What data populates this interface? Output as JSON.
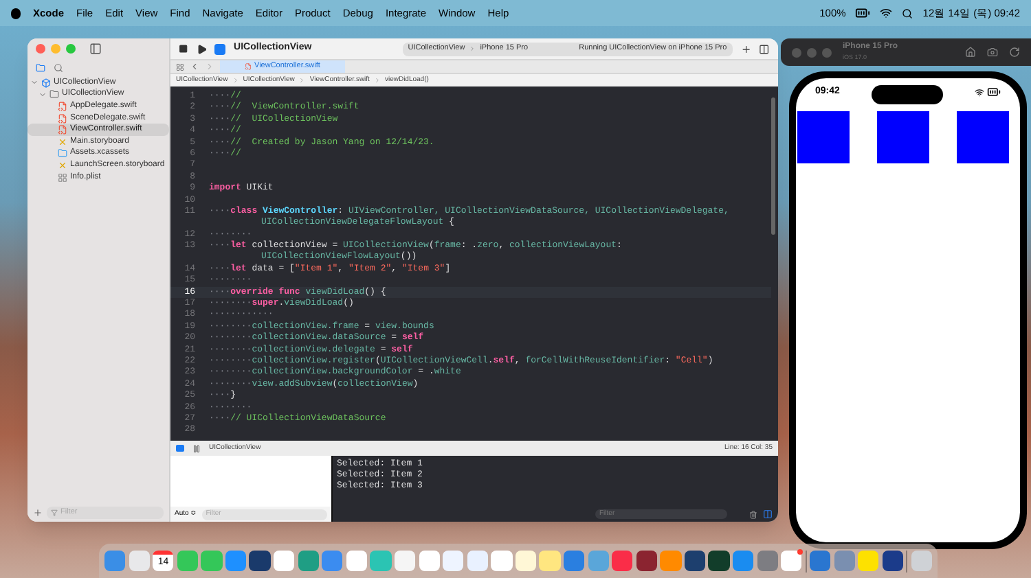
{
  "menu_bar": {
    "items": [
      "Xcode",
      "File",
      "Edit",
      "View",
      "Find",
      "Navigate",
      "Editor",
      "Product",
      "Debug",
      "Integrate",
      "Window",
      "Help"
    ],
    "battery": "100%",
    "clock": "12월 14일 (목) 09:42"
  },
  "xcode": {
    "toolbar": {
      "project": "UICollectionView",
      "scheme": "UICollectionView",
      "device": "iPhone 15 Pro",
      "status": "Running UICollectionView on iPhone 15 Pro"
    },
    "tabs": [
      {
        "label": "ViewController.swift",
        "selected": true
      }
    ],
    "breadcrumb": [
      "UICollectionView",
      "UICollectionView",
      "ViewController.swift",
      "viewDidLoad()"
    ],
    "navigator": {
      "tree": [
        {
          "label": "UICollectionView",
          "kind": "project",
          "expanded": true,
          "selected": false,
          "children": [
            {
              "label": "UICollectionView",
              "kind": "folder",
              "expanded": true,
              "selected": false,
              "children": [
                {
                  "label": "AppDelegate.swift",
                  "kind": "swift",
                  "selected": false
                },
                {
                  "label": "SceneDelegate.swift",
                  "kind": "swift",
                  "selected": false
                },
                {
                  "label": "ViewController.swift",
                  "kind": "swift",
                  "selected": true
                },
                {
                  "label": "Main.storyboard",
                  "kind": "storyboard",
                  "selected": false
                },
                {
                  "label": "Assets.xcassets",
                  "kind": "assets",
                  "selected": false
                },
                {
                  "label": "LaunchScreen.storyboard",
                  "kind": "storyboard",
                  "selected": false
                },
                {
                  "label": "Info.plist",
                  "kind": "plist",
                  "selected": false
                }
              ]
            }
          ]
        }
      ],
      "filter_placeholder": "Filter"
    },
    "editor": {
      "lines": [
        {
          "number": "1",
          "selected": false,
          "tokens": [
            {
              "kind": "space",
              "text": "····"
            },
            {
              "kind": "comment",
              "text": "//"
            }
          ]
        },
        {
          "number": "2",
          "selected": false,
          "tokens": [
            {
              "kind": "space",
              "text": "····"
            },
            {
              "kind": "comment",
              "text": "//  ViewController.swift"
            }
          ]
        },
        {
          "number": "3",
          "selected": false,
          "tokens": [
            {
              "kind": "space",
              "text": "····"
            },
            {
              "kind": "comment",
              "text": "//  UICollectionView"
            }
          ]
        },
        {
          "number": "4",
          "selected": false,
          "tokens": [
            {
              "kind": "space",
              "text": "····"
            },
            {
              "kind": "comment",
              "text": "//"
            }
          ]
        },
        {
          "number": "5",
          "selected": false,
          "tokens": [
            {
              "kind": "space",
              "text": "····"
            },
            {
              "kind": "comment",
              "text": "//  Created by Jason Yang on 12/14/23."
            }
          ]
        },
        {
          "number": "6",
          "selected": false,
          "tokens": [
            {
              "kind": "space",
              "text": "····"
            },
            {
              "kind": "comment",
              "text": "//"
            }
          ]
        },
        {
          "number": "7",
          "selected": false
        },
        {
          "number": "8",
          "selected": false
        },
        {
          "number": "9",
          "selected": false,
          "tokens": [
            {
              "kind": "keyword",
              "text": "import"
            },
            {
              "kind": "plain",
              "text": " UIKit"
            }
          ]
        },
        {
          "number": "10",
          "selected": false
        },
        {
          "number": "11",
          "selected": false,
          "tokens": [
            {
              "kind": "space",
              "text": "····"
            },
            {
              "kind": "keyword",
              "text": "class "
            },
            {
              "kind": "decl",
              "text": "ViewController"
            },
            {
              "kind": "plain",
              "text": ": "
            },
            {
              "kind": "type",
              "text": "UIViewController, UICollectionViewDataSource, UICollectionViewDelegate,"
            }
          ],
          "wrap": [
            {
              "kind": "type",
              "text": "UICollectionViewDelegateFlowLayout"
            },
            {
              "kind": "plain",
              "text": " {"
            }
          ]
        },
        {
          "number": "12",
          "selected": false,
          "tokens": [
            {
              "kind": "space",
              "text": "········"
            }
          ]
        },
        {
          "number": "13",
          "selected": false,
          "tokens": [
            {
              "kind": "space",
              "text": "····"
            },
            {
              "kind": "keyword",
              "text": "let"
            },
            {
              "kind": "plain",
              "text": " collectionView = "
            },
            {
              "kind": "type",
              "text": "UICollectionView"
            },
            {
              "kind": "plain",
              "text": "("
            },
            {
              "kind": "member",
              "text": "frame"
            },
            {
              "kind": "plain",
              "text": ": ."
            },
            {
              "kind": "member",
              "text": "zero"
            },
            {
              "kind": "plain",
              "text": ", "
            },
            {
              "kind": "member",
              "text": "collectionViewLayout"
            },
            {
              "kind": "plain",
              "text": ":"
            }
          ],
          "wrap": [
            {
              "kind": "type",
              "text": "UICollectionViewFlowLayout"
            },
            {
              "kind": "plain",
              "text": "())"
            }
          ]
        },
        {
          "number": "14",
          "selected": false,
          "tokens": [
            {
              "kind": "space",
              "text": "····"
            },
            {
              "kind": "keyword",
              "text": "let"
            },
            {
              "kind": "plain",
              "text": " data = ["
            },
            {
              "kind": "string",
              "text": "\"Item 1\""
            },
            {
              "kind": "plain",
              "text": ", "
            },
            {
              "kind": "string",
              "text": "\"Item 2\""
            },
            {
              "kind": "plain",
              "text": ", "
            },
            {
              "kind": "string",
              "text": "\"Item 3\""
            },
            {
              "kind": "plain",
              "text": "]"
            }
          ]
        },
        {
          "number": "15",
          "selected": false,
          "tokens": [
            {
              "kind": "space",
              "text": "········"
            }
          ]
        },
        {
          "number": "16",
          "selected": true,
          "tokens": [
            {
              "kind": "space",
              "text": "····"
            },
            {
              "kind": "keyword",
              "text": "override func "
            },
            {
              "kind": "member",
              "text": "viewDidLoad"
            },
            {
              "kind": "plain",
              "text": "() {"
            }
          ]
        },
        {
          "number": "17",
          "selected": false,
          "tokens": [
            {
              "kind": "space",
              "text": "········"
            },
            {
              "kind": "keyword",
              "text": "super"
            },
            {
              "kind": "plain",
              "text": "."
            },
            {
              "kind": "member",
              "text": "viewDidLoad"
            },
            {
              "kind": "plain",
              "text": "()"
            }
          ]
        },
        {
          "number": "18",
          "selected": false,
          "tokens": [
            {
              "kind": "space",
              "text": "············"
            }
          ]
        },
        {
          "number": "19",
          "selected": false,
          "tokens": [
            {
              "kind": "space",
              "text": "········"
            },
            {
              "kind": "member",
              "text": "collectionView.frame"
            },
            {
              "kind": "plain",
              "text": " = "
            },
            {
              "kind": "member",
              "text": "view.bounds"
            }
          ]
        },
        {
          "number": "20",
          "selected": false,
          "tokens": [
            {
              "kind": "space",
              "text": "········"
            },
            {
              "kind": "member",
              "text": "collectionView.dataSource"
            },
            {
              "kind": "plain",
              "text": " = "
            },
            {
              "kind": "keyword",
              "text": "self"
            }
          ]
        },
        {
          "number": "21",
          "selected": false,
          "tokens": [
            {
              "kind": "space",
              "text": "········"
            },
            {
              "kind": "member",
              "text": "collectionView.delegate"
            },
            {
              "kind": "plain",
              "text": " = "
            },
            {
              "kind": "keyword",
              "text": "self"
            }
          ]
        },
        {
          "number": "22",
          "selected": false,
          "tokens": [
            {
              "kind": "space",
              "text": "········"
            },
            {
              "kind": "member",
              "text": "collectionView.register"
            },
            {
              "kind": "plain",
              "text": "("
            },
            {
              "kind": "type",
              "text": "UICollectionViewCell"
            },
            {
              "kind": "plain",
              "text": "."
            },
            {
              "kind": "keyword",
              "text": "self"
            },
            {
              "kind": "plain",
              "text": ", "
            },
            {
              "kind": "member",
              "text": "forCellWithReuseIdentifier"
            },
            {
              "kind": "plain",
              "text": ": "
            },
            {
              "kind": "string",
              "text": "\"Cell\""
            },
            {
              "kind": "plain",
              "text": ")"
            }
          ]
        },
        {
          "number": "23",
          "selected": false,
          "tokens": [
            {
              "kind": "space",
              "text": "········"
            },
            {
              "kind": "member",
              "text": "collectionView.backgroundColor"
            },
            {
              "kind": "plain",
              "text": " = ."
            },
            {
              "kind": "member",
              "text": "white"
            }
          ]
        },
        {
          "number": "24",
          "selected": false,
          "tokens": [
            {
              "kind": "space",
              "text": "········"
            },
            {
              "kind": "member",
              "text": "view.addSubview"
            },
            {
              "kind": "plain",
              "text": "("
            },
            {
              "kind": "member",
              "text": "collectionView"
            },
            {
              "kind": "plain",
              "text": ")"
            }
          ]
        },
        {
          "number": "25",
          "selected": false,
          "tokens": [
            {
              "kind": "space",
              "text": "····"
            },
            {
              "kind": "plain",
              "text": "}"
            }
          ]
        },
        {
          "number": "26",
          "selected": false,
          "tokens": [
            {
              "kind": "space",
              "text": "········"
            }
          ]
        },
        {
          "number": "27",
          "selected": false,
          "tokens": [
            {
              "kind": "space",
              "text": "····"
            },
            {
              "kind": "comment",
              "text": "// UICollectionViewDataSource"
            }
          ]
        },
        {
          "number": "28",
          "selected": false
        }
      ]
    },
    "debug_bar": {
      "target": "UICollectionView",
      "position": "Line: 16  Col: 35"
    },
    "variables": {
      "scope": "Auto ≎",
      "filter_placeholder": "Filter"
    },
    "console": {
      "lines": [
        "Selected: Item 1",
        "Selected: Item 2",
        "Selected: Item 3"
      ],
      "filter_placeholder": "Filter"
    }
  },
  "simulator": {
    "title": "iPhone 15 Pro",
    "subtitle": "iOS 17.0",
    "status_time": "09:42",
    "cells": [
      {
        "color": "#0000ff"
      },
      {
        "color": "#0000ff"
      },
      {
        "color": "#0000ff"
      }
    ]
  },
  "dock": {
    "calendar_day": "14"
  }
}
